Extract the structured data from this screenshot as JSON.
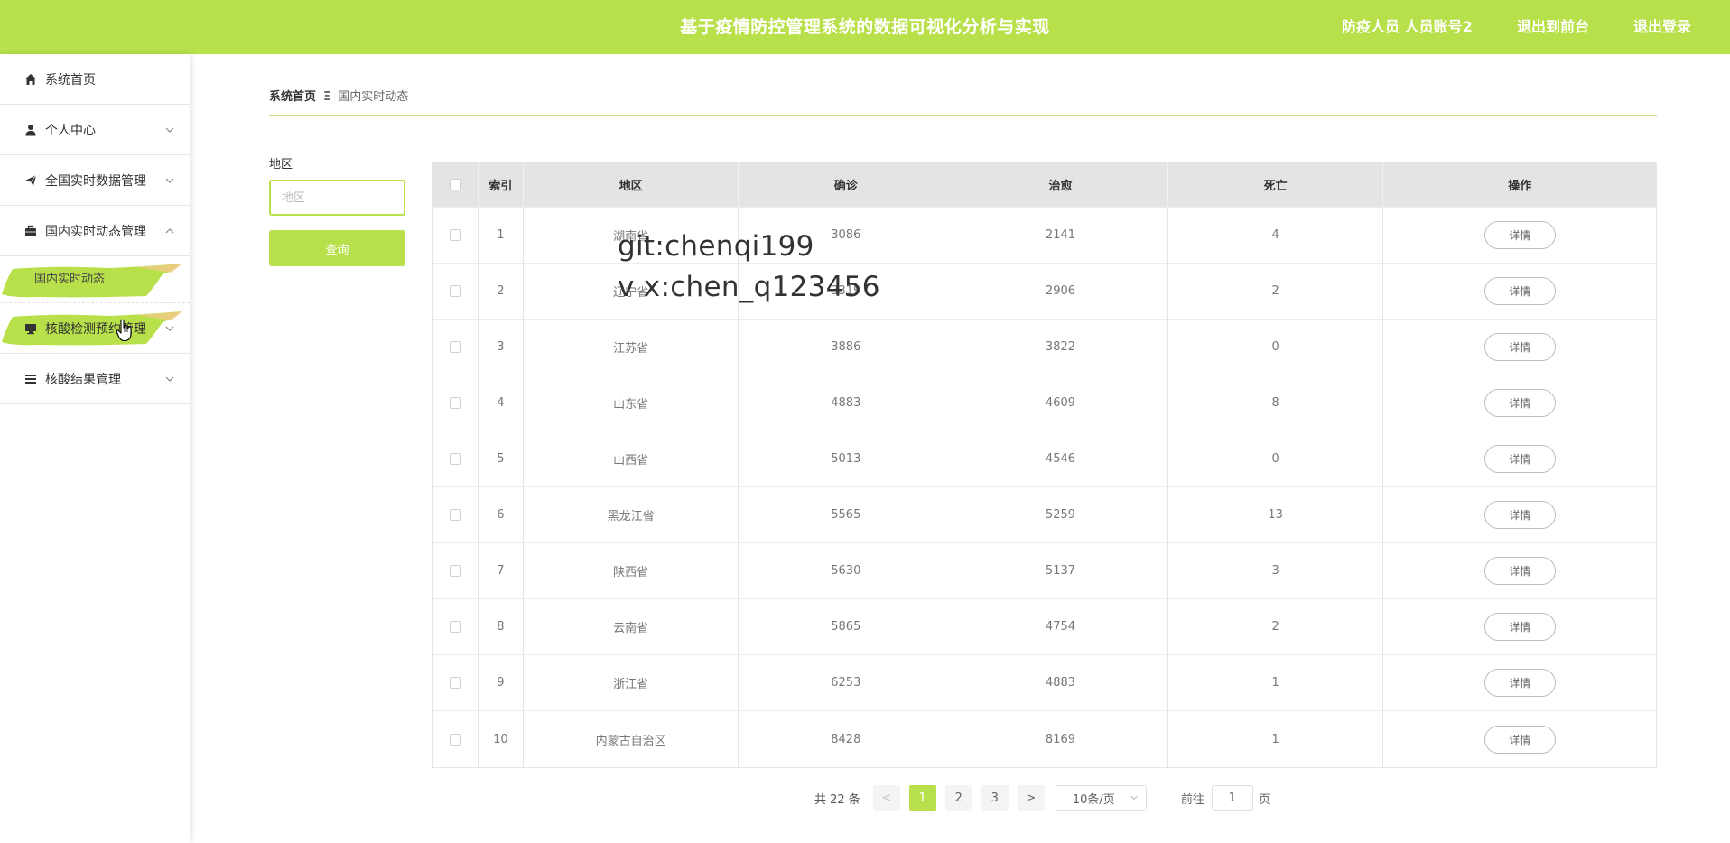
{
  "header": {
    "title": "基于疫情防控管理系统的数据可视化分析与实现",
    "user": "防疫人员 人员账号2",
    "front_label": "退出到前台",
    "logout_label": "退出登录",
    "bg_color": "#b8e04a"
  },
  "sidebar": {
    "items": [
      {
        "label": "系统首页",
        "icon": "home-icon"
      },
      {
        "label": "个人中心",
        "icon": "user-icon"
      },
      {
        "label": "全国实时数据管理",
        "icon": "send-icon"
      },
      {
        "label": "国内实时动态管理",
        "icon": "briefcase-icon"
      },
      {
        "label": "国内实时动态",
        "icon": ""
      },
      {
        "label": "核酸检测预约管理",
        "icon": "monitor-icon"
      },
      {
        "label": "核酸结果管理",
        "icon": "list-icon"
      }
    ]
  },
  "breadcrumb": {
    "home": "系统首页",
    "sep": "Ξ",
    "current": "国内实时动态"
  },
  "filter": {
    "label": "地区",
    "placeholder": "地区",
    "button": "查询"
  },
  "table": {
    "headers": [
      "索引",
      "地区",
      "确诊",
      "治愈",
      "死亡",
      "操作"
    ],
    "action_label": "详情",
    "rows": [
      [
        "1",
        "湖南省",
        "3086",
        "2141",
        "4"
      ],
      [
        "2",
        "辽宁省",
        "3319",
        "2906",
        "2"
      ],
      [
        "3",
        "江苏省",
        "3886",
        "3822",
        "0"
      ],
      [
        "4",
        "山东省",
        "4883",
        "4609",
        "8"
      ],
      [
        "5",
        "山西省",
        "5013",
        "4546",
        "0"
      ],
      [
        "6",
        "黑龙江省",
        "5565",
        "5259",
        "13"
      ],
      [
        "7",
        "陕西省",
        "5630",
        "5137",
        "3"
      ],
      [
        "8",
        "云南省",
        "5865",
        "4754",
        "2"
      ],
      [
        "9",
        "浙江省",
        "6253",
        "4883",
        "1"
      ],
      [
        "10",
        "内蒙古自治区",
        "8428",
        "8169",
        "1"
      ]
    ]
  },
  "watermark": {
    "line1": "git:chenqi199",
    "line2": "v x:chen_q123456"
  },
  "pagination": {
    "total": "共 22 条",
    "prev": "<",
    "pages": [
      "1",
      "2",
      "3"
    ],
    "current": "1",
    "next": ">",
    "page_size": "10条/页",
    "goto_prefix": "前往",
    "goto_value": "1",
    "goto_suffix": "页"
  }
}
